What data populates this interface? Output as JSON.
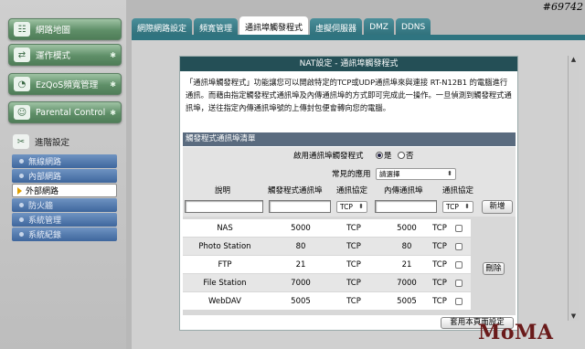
{
  "watermark_id": "#69742",
  "watermark_logo": "MoMA",
  "sidebar": {
    "menu": [
      {
        "label": "網路地圖",
        "icon": "network-map-icon",
        "glyph": "☷"
      },
      {
        "label": "運作模式",
        "icon": "mode-icon",
        "glyph": "⇄"
      },
      {
        "label": "EzQoS頻寬管理",
        "icon": "qos-icon",
        "glyph": "◔"
      },
      {
        "label": "Parental Control",
        "icon": "parental-icon",
        "glyph": "☺"
      }
    ],
    "advanced_label": "進階設定",
    "sub": [
      {
        "label": "無線網路"
      },
      {
        "label": "內部網路"
      },
      {
        "label": "外部網路",
        "active": true
      },
      {
        "label": "防火牆"
      },
      {
        "label": "系統管理"
      },
      {
        "label": "系統紀錄"
      }
    ]
  },
  "tabs": [
    {
      "label": "網際網路設定"
    },
    {
      "label": "頻寬管理"
    },
    {
      "label": "通訊埠觸發程式",
      "active": true
    },
    {
      "label": "虛擬伺服器"
    },
    {
      "label": "DMZ"
    },
    {
      "label": "DDNS"
    }
  ],
  "panel": {
    "title": "NAT設定 - 通訊埠觸發程式",
    "description": "「通訊埠觸發程式」功能讓您可以開啟特定的TCP或UDP通訊埠來與連接 RT-N12B1 的電腦進行通訊。而藉由指定觸發程式通訊埠及內傳通訊埠的方式即可完成此一操作。一旦偵測到觸發程式通訊埠，送往指定內傳通訊埠號的上傳封包便會轉向您的電腦。",
    "section_title": "觸發程式通訊埠清單",
    "enable_label": "啟用通訊埠觸發程式",
    "yes": "是",
    "no": "否",
    "common_label": "常見的應用",
    "common_select": "請選擇",
    "columns": [
      "說明",
      "觸發程式通訊埠",
      "通訊協定",
      "內傳通訊埠",
      "通訊協定"
    ],
    "new_protocol_1": "TCP",
    "new_protocol_2": "TCP",
    "add_button": "新增",
    "delete_button": "刪除",
    "apply_button": "套用本頁面設定",
    "rows": [
      {
        "desc": "NAS",
        "trigger": "5000",
        "proto1": "TCP",
        "incoming": "5000",
        "proto2": "TCP"
      },
      {
        "desc": "Photo Station",
        "trigger": "80",
        "proto1": "TCP",
        "incoming": "80",
        "proto2": "TCP"
      },
      {
        "desc": "FTP",
        "trigger": "21",
        "proto1": "TCP",
        "incoming": "21",
        "proto2": "TCP"
      },
      {
        "desc": "File Station",
        "trigger": "7000",
        "proto1": "TCP",
        "incoming": "7000",
        "proto2": "TCP"
      },
      {
        "desc": "WebDAV",
        "trigger": "5005",
        "proto1": "TCP",
        "incoming": "5005",
        "proto2": "TCP"
      }
    ]
  }
}
